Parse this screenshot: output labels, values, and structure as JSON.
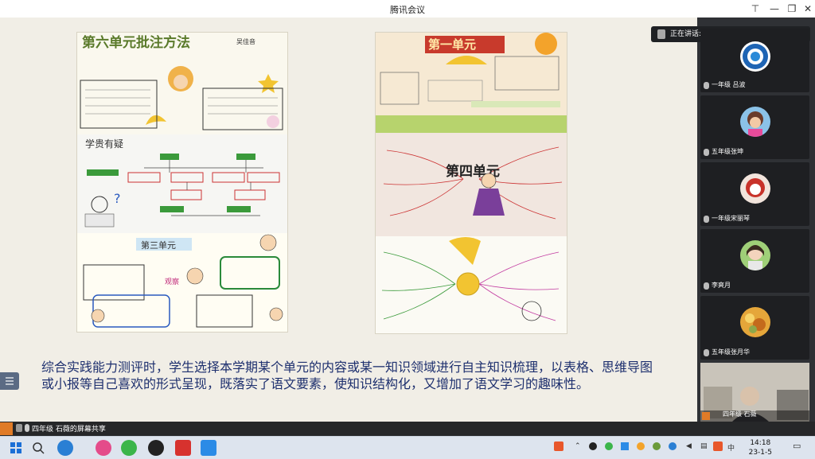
{
  "window": {
    "title": "腾讯会议"
  },
  "main": {
    "caption": "综合实践能力测评时，学生选择本学期某个单元的内容或某一知识领域进行自主知识梳理，以表格、思维导图或小报等自己喜欢的形式呈现，既落实了语文要素，使知识结构化，又增加了语文学习的趣味性。",
    "left_panel": {
      "top_title": "第六单元批注方法",
      "top_author": "吴佳音",
      "middle_title": "学贵有疑",
      "bottom_title": "第三单元",
      "bottom_label": "观察"
    },
    "right_panel": {
      "top_title": "第一单元",
      "middle_title": "第四单元"
    }
  },
  "sidebar": {
    "speaking": "正在讲话: 四年级  石薇",
    "participants": [
      {
        "name": "一年级 吕波"
      },
      {
        "name": "五年级张坤"
      },
      {
        "name": "一年级宋丽琴"
      },
      {
        "name": "李爽月"
      },
      {
        "name": "五年级张月华"
      },
      {
        "name": "四年级  石薇"
      }
    ]
  },
  "statusbar": {
    "sharing": "四年级  石薇的屏幕共享"
  },
  "taskbar": {
    "time": "14:18",
    "date": "23-1-5",
    "ime": "中"
  },
  "colors": {
    "caption": "#1d2f6e",
    "sidebar": "#2f3135",
    "accent": "#e07b27"
  }
}
